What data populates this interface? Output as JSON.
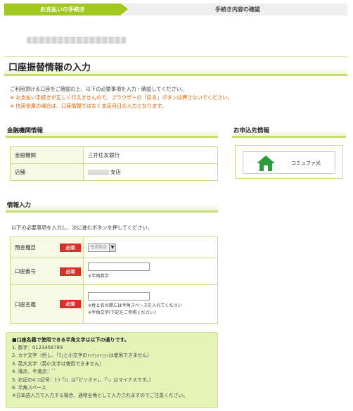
{
  "steps": {
    "step1": "お支払いの手続き",
    "step2": "手続き内容の確認"
  },
  "page": {
    "title": "口座振替情報の入力",
    "intro": [
      "ご利用頂ける口座をご確認の上、以下の必要事項を入力・確認してください。",
      "※ お支払い手続きが正しく行えませんので、ブラウザーの「戻る」ボタンは押さないでください。",
      "※ 信用金庫の場合は、口座情報ではなく支店月日の入力となります。"
    ]
  },
  "bank_section": {
    "header": "金融機関情報",
    "rows": [
      {
        "label": "金融機関",
        "value": "三井住友銀行"
      },
      {
        "label": "店舗",
        "value": "支店"
      }
    ]
  },
  "applicant_section": {
    "header": "お申込先情報",
    "label": "コミュファ光",
    "icon": "home-icon",
    "icon_color": "#2a9d3a"
  },
  "input_section": {
    "header": "情報入力",
    "description": "以下の必要事項を入力し、次に進むボタンを押してください。",
    "required_label": "必須",
    "fields": {
      "deposit_type": {
        "label": "預金種目",
        "selected": "普通預金"
      },
      "account_number": {
        "label": "口座番号",
        "value": "",
        "note": "※半角数字"
      },
      "account_name": {
        "label": "口座名義",
        "value": "",
        "notes": [
          "※姓と名の間には半角スペースを入れてください",
          "※半角文字(下記をご参照ください)"
        ]
      }
    }
  },
  "info_box": {
    "heading": "■口座名義で使用できる半角文字は以下の通りです。",
    "items": [
      "1. 数字：0123456789",
      "2. カナ文字（但し、｢ｦ｣と小文字のｧｨｩｪｫｬｭｮｯは使用できません）",
      "3. 英大文字（英小文字は使用できません）",
      "4. 濁点、半濁点：ﾞﾟ",
      "5. 右記の4つ記号：(-)「/」は｢ピリオド｣、「-」はマイナスです。）",
      "6. 半角スペース",
      "※日本語入力で入力する場合、通常全角として入力されますのでご注意ください。"
    ]
  },
  "colors": {
    "accent_green": "#a0c81e",
    "required_red": "#d9302b",
    "warning_orange": "#e35d00"
  }
}
